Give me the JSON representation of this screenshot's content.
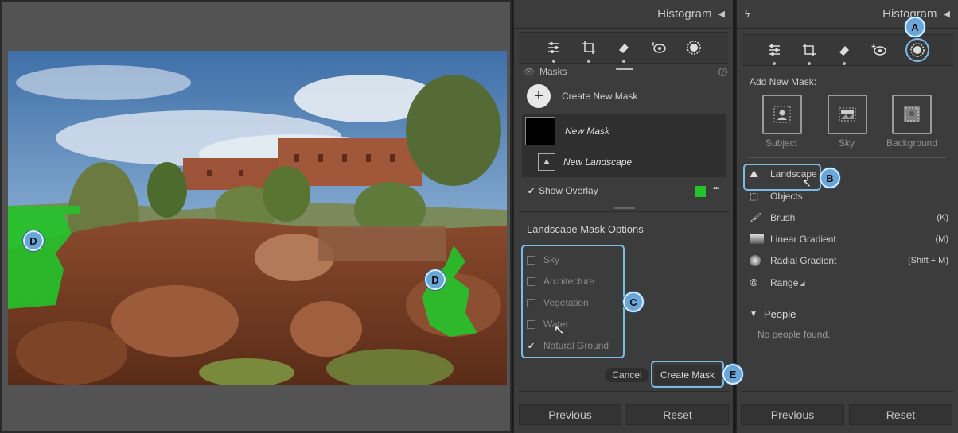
{
  "colors": {
    "accent": "#6aa7d8",
    "overlay_green": "#22c42a",
    "panel_bg": "#3c3c3c"
  },
  "callouts": {
    "a": "A",
    "b": "B",
    "c": "C",
    "d1": "D",
    "d2": "D",
    "e": "E"
  },
  "mid_panel": {
    "header": "Histogram",
    "tools": [
      "sliders-icon",
      "crop-icon",
      "eraser-icon",
      "redeye-icon",
      "mask-icon"
    ],
    "masks_title": "Masks",
    "create_new_mask": "Create New Mask",
    "new_mask": "New Mask",
    "new_landscape": "New Landscape",
    "show_overlay": "Show Overlay",
    "more": "•••",
    "options_title": "Landscape Mask Options",
    "options": [
      {
        "label": "Sky",
        "checked": false
      },
      {
        "label": "Architecture",
        "checked": false
      },
      {
        "label": "Vegetation",
        "checked": false
      },
      {
        "label": "Water",
        "checked": false
      },
      {
        "label": "Natural Ground",
        "checked": true
      }
    ],
    "cancel": "Cancel",
    "create_mask": "Create Mask",
    "previous": "Previous",
    "reset": "Reset"
  },
  "right_panel": {
    "header": "Histogram",
    "add_new_mask": "Add New Mask:",
    "tiles": [
      "Subject",
      "Sky",
      "Background"
    ],
    "list": [
      {
        "label": "Landscape",
        "shortcut": "",
        "icon": "landscape-icon"
      },
      {
        "label": "Objects",
        "shortcut": "",
        "icon": "objects-icon"
      },
      {
        "label": "Brush",
        "shortcut": "(K)",
        "icon": "brush-icon"
      },
      {
        "label": "Linear Gradient",
        "shortcut": "(M)",
        "icon": "linear-gradient-icon"
      },
      {
        "label": "Radial Gradient",
        "shortcut": "(Shift + M)",
        "icon": "radial-gradient-icon"
      },
      {
        "label": "Range",
        "shortcut": "",
        "icon": "range-icon"
      }
    ],
    "people_title": "People",
    "no_people": "No people found.",
    "previous": "Previous",
    "reset": "Reset"
  }
}
